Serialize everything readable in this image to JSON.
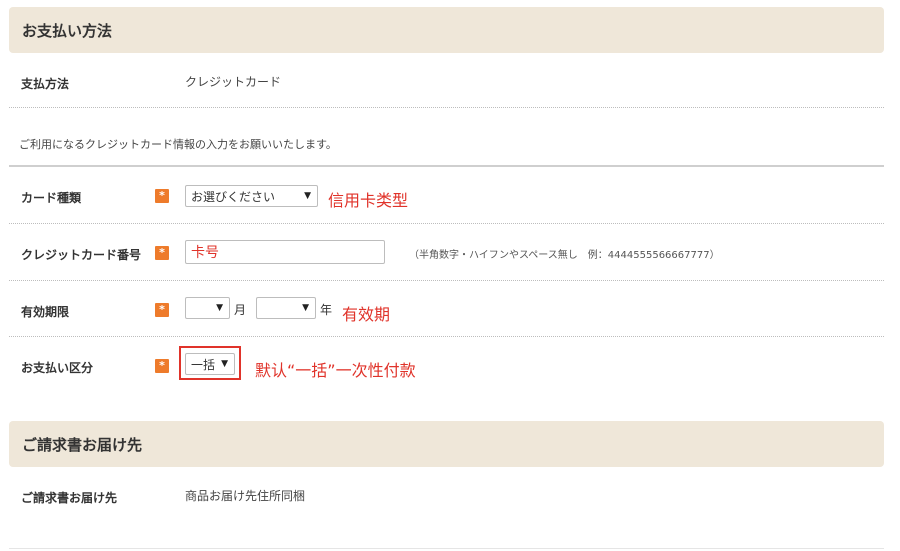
{
  "payment_section": {
    "title": "お支払い方法",
    "method_label": "支払方法",
    "method_value": "クレジットカード",
    "instruction": "ご利用になるクレジットカード情報の入力をお願いいたします。",
    "card_type": {
      "label": "カード種類",
      "select_value": "お選びください",
      "annotation": "信用卡类型"
    },
    "card_number": {
      "label": "クレジットカード番号",
      "input_value": "卡号",
      "hint": "（半角数字・ハイフンやスペース無し　例：4444555566667777）"
    },
    "expiry": {
      "label": "有効期限",
      "month_value": "",
      "month_unit": "月",
      "year_value": "",
      "year_unit": "年",
      "annotation": "有效期"
    },
    "installment": {
      "label": "お支払い区分",
      "select_value": "一括",
      "annotation": "默认“一括”一次性付款"
    },
    "required_mark": "*"
  },
  "billing_section": {
    "title": "ご請求書お届け先",
    "label": "ご請求書お届け先",
    "value": "商品お届け先住所同梱"
  }
}
